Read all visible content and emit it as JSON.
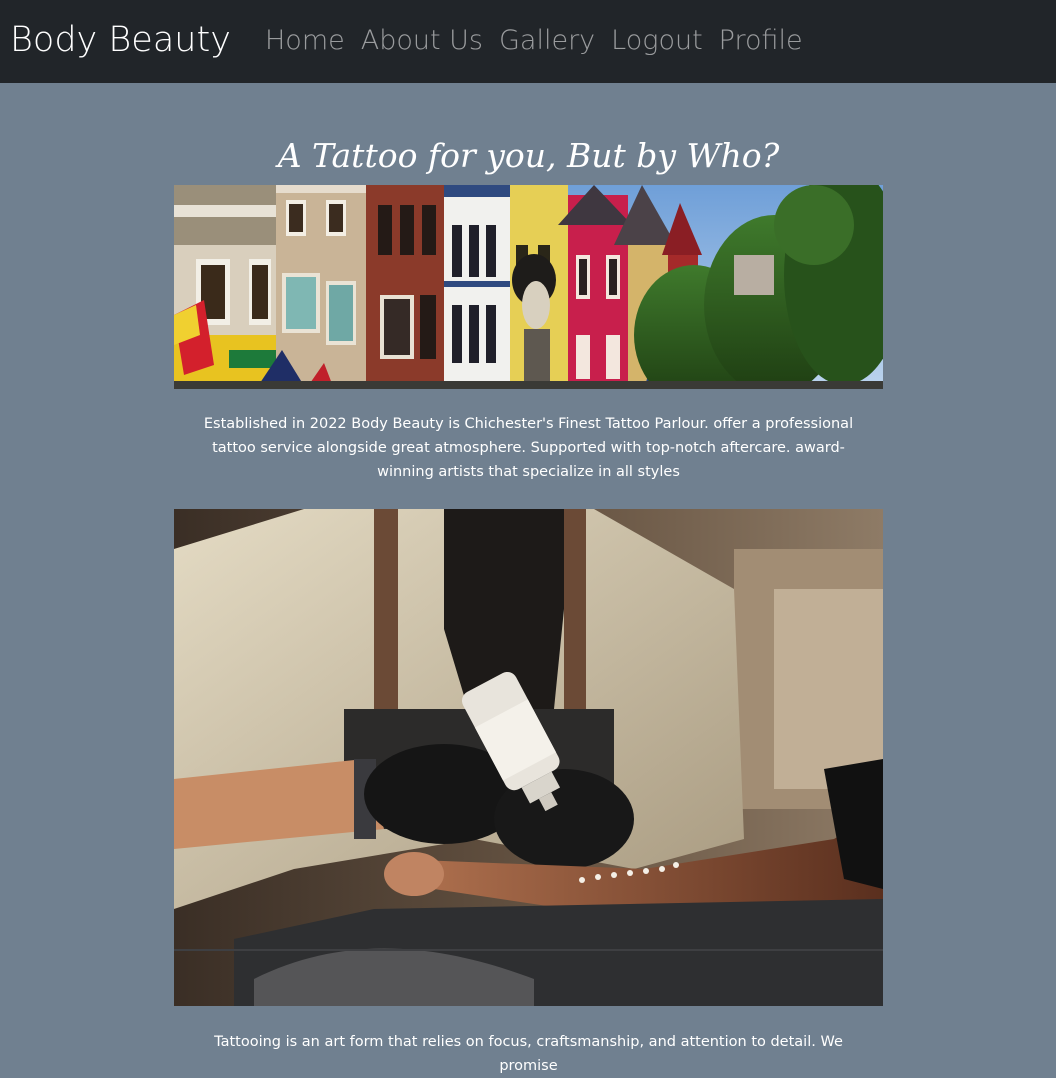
{
  "navbar": {
    "brand": "Body Beauty",
    "links": [
      {
        "label": "Home"
      },
      {
        "label": "About Us"
      },
      {
        "label": "Gallery"
      },
      {
        "label": "Logout"
      },
      {
        "label": "Profile"
      }
    ]
  },
  "main": {
    "heading": "A Tattoo for you, But by Who?",
    "intro": "Established in 2022 Body Beauty is Chichester's Finest Tattoo Parlour. offer a professional tattoo service alongside great atmosphere. Supported with top-notch aftercare. award-winning artists that specialize in all styles",
    "outro": "Tattooing is an art form that relies on focus, craftsmanship, and attention to detail. We promise"
  },
  "colors": {
    "navbar_bg": "#212529",
    "page_bg": "#708090",
    "text": "#ffffff",
    "nav_link": "rgba(255,255,255,0.55)"
  }
}
